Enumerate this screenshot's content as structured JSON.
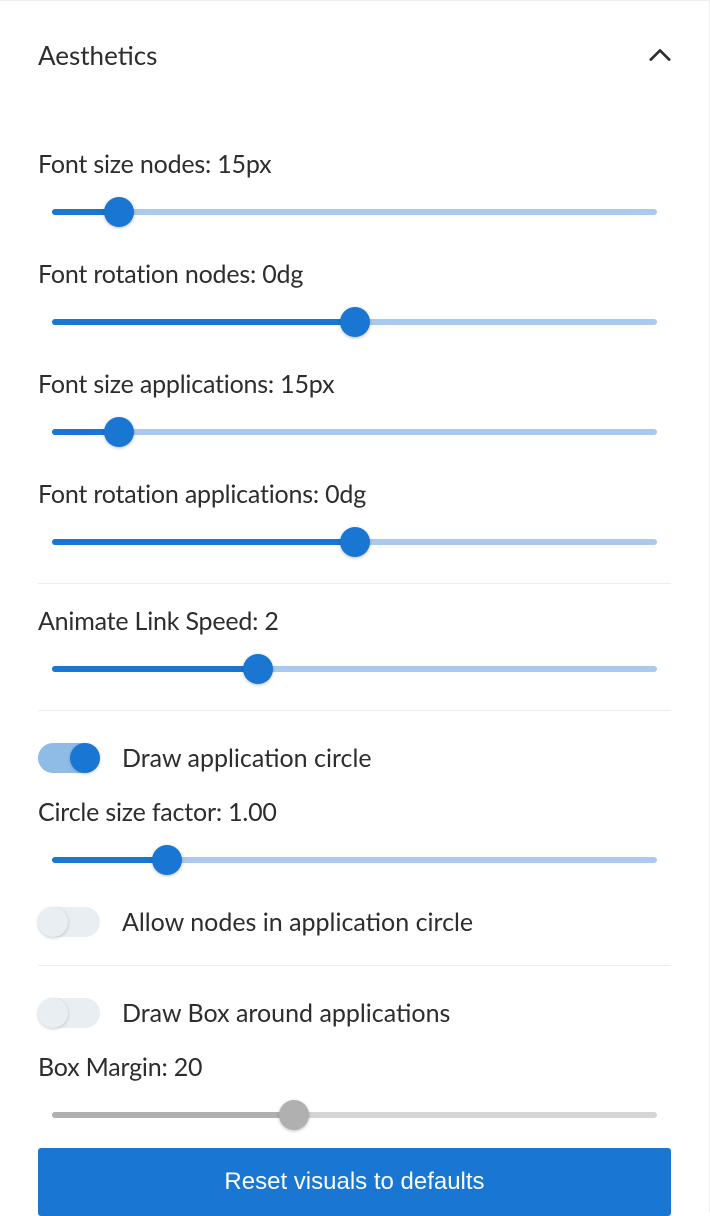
{
  "section": {
    "title": "Aesthetics",
    "expanded": true
  },
  "sliders": {
    "fontSizeNodes": {
      "label": "Font size nodes: 15px",
      "percent": 11,
      "enabled": true
    },
    "fontRotationNodes": {
      "label": "Font rotation nodes: 0dg",
      "percent": 50,
      "enabled": true
    },
    "fontSizeApps": {
      "label": "Font size applications: 15px",
      "percent": 11,
      "enabled": true
    },
    "fontRotationApps": {
      "label": "Font rotation applications: 0dg",
      "percent": 50,
      "enabled": true
    },
    "animateLinkSpeed": {
      "label": "Animate Link Speed: 2",
      "percent": 34,
      "enabled": true
    },
    "circleSizeFactor": {
      "label": "Circle size factor: 1.00",
      "percent": 19,
      "enabled": true
    },
    "boxMargin": {
      "label": "Box Margin: 20",
      "percent": 40,
      "enabled": false
    }
  },
  "toggles": {
    "drawAppCircle": {
      "label": "Draw application circle",
      "on": true
    },
    "allowNodesInCircle": {
      "label": "Allow nodes in application circle",
      "on": false
    },
    "drawBoxApps": {
      "label": "Draw Box around applications",
      "on": false
    }
  },
  "buttons": {
    "reset": "Reset visuals to defaults"
  }
}
